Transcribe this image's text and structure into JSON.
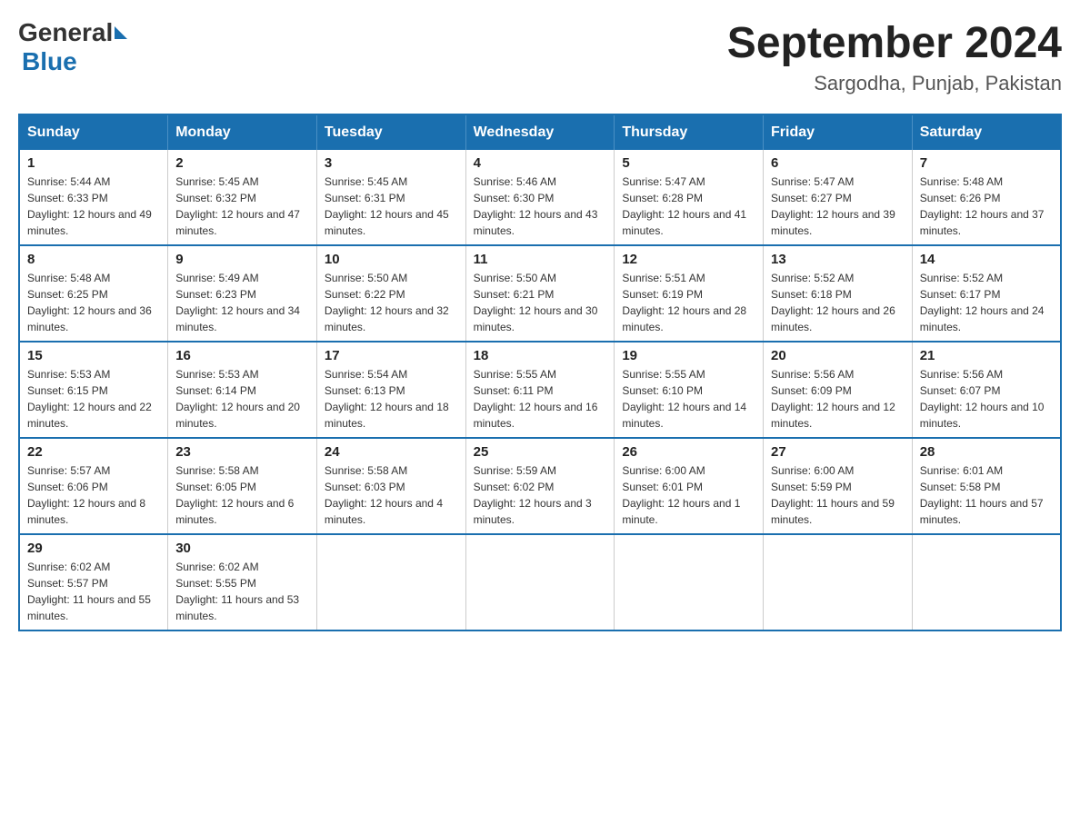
{
  "logo": {
    "general": "General",
    "blue": "Blue"
  },
  "title": {
    "month_year": "September 2024",
    "location": "Sargodha, Punjab, Pakistan"
  },
  "headers": [
    "Sunday",
    "Monday",
    "Tuesday",
    "Wednesday",
    "Thursday",
    "Friday",
    "Saturday"
  ],
  "weeks": [
    [
      {
        "day": "1",
        "sunrise": "Sunrise: 5:44 AM",
        "sunset": "Sunset: 6:33 PM",
        "daylight": "Daylight: 12 hours and 49 minutes."
      },
      {
        "day": "2",
        "sunrise": "Sunrise: 5:45 AM",
        "sunset": "Sunset: 6:32 PM",
        "daylight": "Daylight: 12 hours and 47 minutes."
      },
      {
        "day": "3",
        "sunrise": "Sunrise: 5:45 AM",
        "sunset": "Sunset: 6:31 PM",
        "daylight": "Daylight: 12 hours and 45 minutes."
      },
      {
        "day": "4",
        "sunrise": "Sunrise: 5:46 AM",
        "sunset": "Sunset: 6:30 PM",
        "daylight": "Daylight: 12 hours and 43 minutes."
      },
      {
        "day": "5",
        "sunrise": "Sunrise: 5:47 AM",
        "sunset": "Sunset: 6:28 PM",
        "daylight": "Daylight: 12 hours and 41 minutes."
      },
      {
        "day": "6",
        "sunrise": "Sunrise: 5:47 AM",
        "sunset": "Sunset: 6:27 PM",
        "daylight": "Daylight: 12 hours and 39 minutes."
      },
      {
        "day": "7",
        "sunrise": "Sunrise: 5:48 AM",
        "sunset": "Sunset: 6:26 PM",
        "daylight": "Daylight: 12 hours and 37 minutes."
      }
    ],
    [
      {
        "day": "8",
        "sunrise": "Sunrise: 5:48 AM",
        "sunset": "Sunset: 6:25 PM",
        "daylight": "Daylight: 12 hours and 36 minutes."
      },
      {
        "day": "9",
        "sunrise": "Sunrise: 5:49 AM",
        "sunset": "Sunset: 6:23 PM",
        "daylight": "Daylight: 12 hours and 34 minutes."
      },
      {
        "day": "10",
        "sunrise": "Sunrise: 5:50 AM",
        "sunset": "Sunset: 6:22 PM",
        "daylight": "Daylight: 12 hours and 32 minutes."
      },
      {
        "day": "11",
        "sunrise": "Sunrise: 5:50 AM",
        "sunset": "Sunset: 6:21 PM",
        "daylight": "Daylight: 12 hours and 30 minutes."
      },
      {
        "day": "12",
        "sunrise": "Sunrise: 5:51 AM",
        "sunset": "Sunset: 6:19 PM",
        "daylight": "Daylight: 12 hours and 28 minutes."
      },
      {
        "day": "13",
        "sunrise": "Sunrise: 5:52 AM",
        "sunset": "Sunset: 6:18 PM",
        "daylight": "Daylight: 12 hours and 26 minutes."
      },
      {
        "day": "14",
        "sunrise": "Sunrise: 5:52 AM",
        "sunset": "Sunset: 6:17 PM",
        "daylight": "Daylight: 12 hours and 24 minutes."
      }
    ],
    [
      {
        "day": "15",
        "sunrise": "Sunrise: 5:53 AM",
        "sunset": "Sunset: 6:15 PM",
        "daylight": "Daylight: 12 hours and 22 minutes."
      },
      {
        "day": "16",
        "sunrise": "Sunrise: 5:53 AM",
        "sunset": "Sunset: 6:14 PM",
        "daylight": "Daylight: 12 hours and 20 minutes."
      },
      {
        "day": "17",
        "sunrise": "Sunrise: 5:54 AM",
        "sunset": "Sunset: 6:13 PM",
        "daylight": "Daylight: 12 hours and 18 minutes."
      },
      {
        "day": "18",
        "sunrise": "Sunrise: 5:55 AM",
        "sunset": "Sunset: 6:11 PM",
        "daylight": "Daylight: 12 hours and 16 minutes."
      },
      {
        "day": "19",
        "sunrise": "Sunrise: 5:55 AM",
        "sunset": "Sunset: 6:10 PM",
        "daylight": "Daylight: 12 hours and 14 minutes."
      },
      {
        "day": "20",
        "sunrise": "Sunrise: 5:56 AM",
        "sunset": "Sunset: 6:09 PM",
        "daylight": "Daylight: 12 hours and 12 minutes."
      },
      {
        "day": "21",
        "sunrise": "Sunrise: 5:56 AM",
        "sunset": "Sunset: 6:07 PM",
        "daylight": "Daylight: 12 hours and 10 minutes."
      }
    ],
    [
      {
        "day": "22",
        "sunrise": "Sunrise: 5:57 AM",
        "sunset": "Sunset: 6:06 PM",
        "daylight": "Daylight: 12 hours and 8 minutes."
      },
      {
        "day": "23",
        "sunrise": "Sunrise: 5:58 AM",
        "sunset": "Sunset: 6:05 PM",
        "daylight": "Daylight: 12 hours and 6 minutes."
      },
      {
        "day": "24",
        "sunrise": "Sunrise: 5:58 AM",
        "sunset": "Sunset: 6:03 PM",
        "daylight": "Daylight: 12 hours and 4 minutes."
      },
      {
        "day": "25",
        "sunrise": "Sunrise: 5:59 AM",
        "sunset": "Sunset: 6:02 PM",
        "daylight": "Daylight: 12 hours and 3 minutes."
      },
      {
        "day": "26",
        "sunrise": "Sunrise: 6:00 AM",
        "sunset": "Sunset: 6:01 PM",
        "daylight": "Daylight: 12 hours and 1 minute."
      },
      {
        "day": "27",
        "sunrise": "Sunrise: 6:00 AM",
        "sunset": "Sunset: 5:59 PM",
        "daylight": "Daylight: 11 hours and 59 minutes."
      },
      {
        "day": "28",
        "sunrise": "Sunrise: 6:01 AM",
        "sunset": "Sunset: 5:58 PM",
        "daylight": "Daylight: 11 hours and 57 minutes."
      }
    ],
    [
      {
        "day": "29",
        "sunrise": "Sunrise: 6:02 AM",
        "sunset": "Sunset: 5:57 PM",
        "daylight": "Daylight: 11 hours and 55 minutes."
      },
      {
        "day": "30",
        "sunrise": "Sunrise: 6:02 AM",
        "sunset": "Sunset: 5:55 PM",
        "daylight": "Daylight: 11 hours and 53 minutes."
      },
      null,
      null,
      null,
      null,
      null
    ]
  ]
}
